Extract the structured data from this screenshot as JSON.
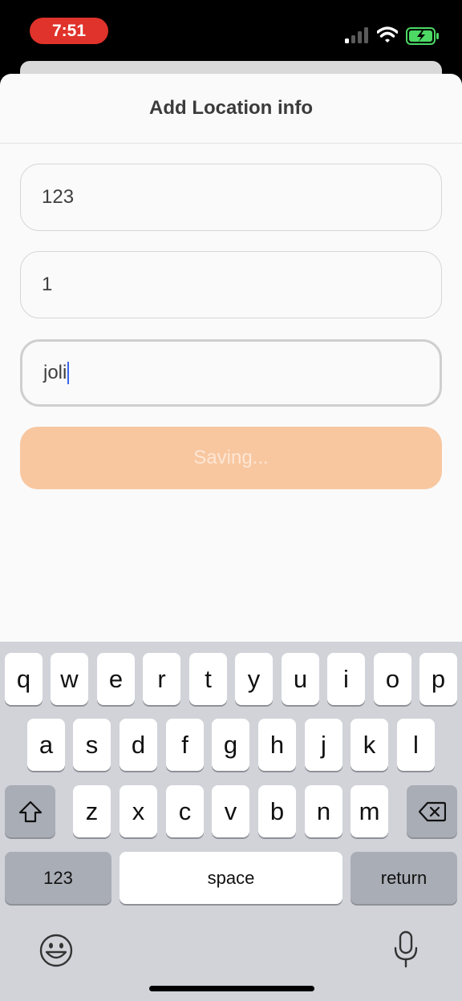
{
  "status_bar": {
    "time": "7:51",
    "icons": [
      "cellular-signal-icon",
      "wifi-icon",
      "battery-charging-icon"
    ]
  },
  "sheet": {
    "title": "Add Location info",
    "fields": [
      {
        "value": "123"
      },
      {
        "value": "1"
      },
      {
        "value": "joli"
      }
    ],
    "save_button_label": "Saving..."
  },
  "keyboard": {
    "row1": [
      "q",
      "w",
      "e",
      "r",
      "t",
      "y",
      "u",
      "i",
      "o",
      "p"
    ],
    "row2": [
      "a",
      "s",
      "d",
      "f",
      "g",
      "h",
      "j",
      "k",
      "l"
    ],
    "row3": [
      "z",
      "x",
      "c",
      "v",
      "b",
      "n",
      "m"
    ],
    "numbers_key": "123",
    "space_key": "space",
    "return_key": "return",
    "icons": [
      "shift-icon",
      "backspace-icon",
      "emoji-icon",
      "microphone-icon"
    ]
  },
  "colors": {
    "time_pill": "#e0332b",
    "save_button": "#f8c7a0",
    "caret": "#3a64e8",
    "battery": "#4cd964"
  }
}
